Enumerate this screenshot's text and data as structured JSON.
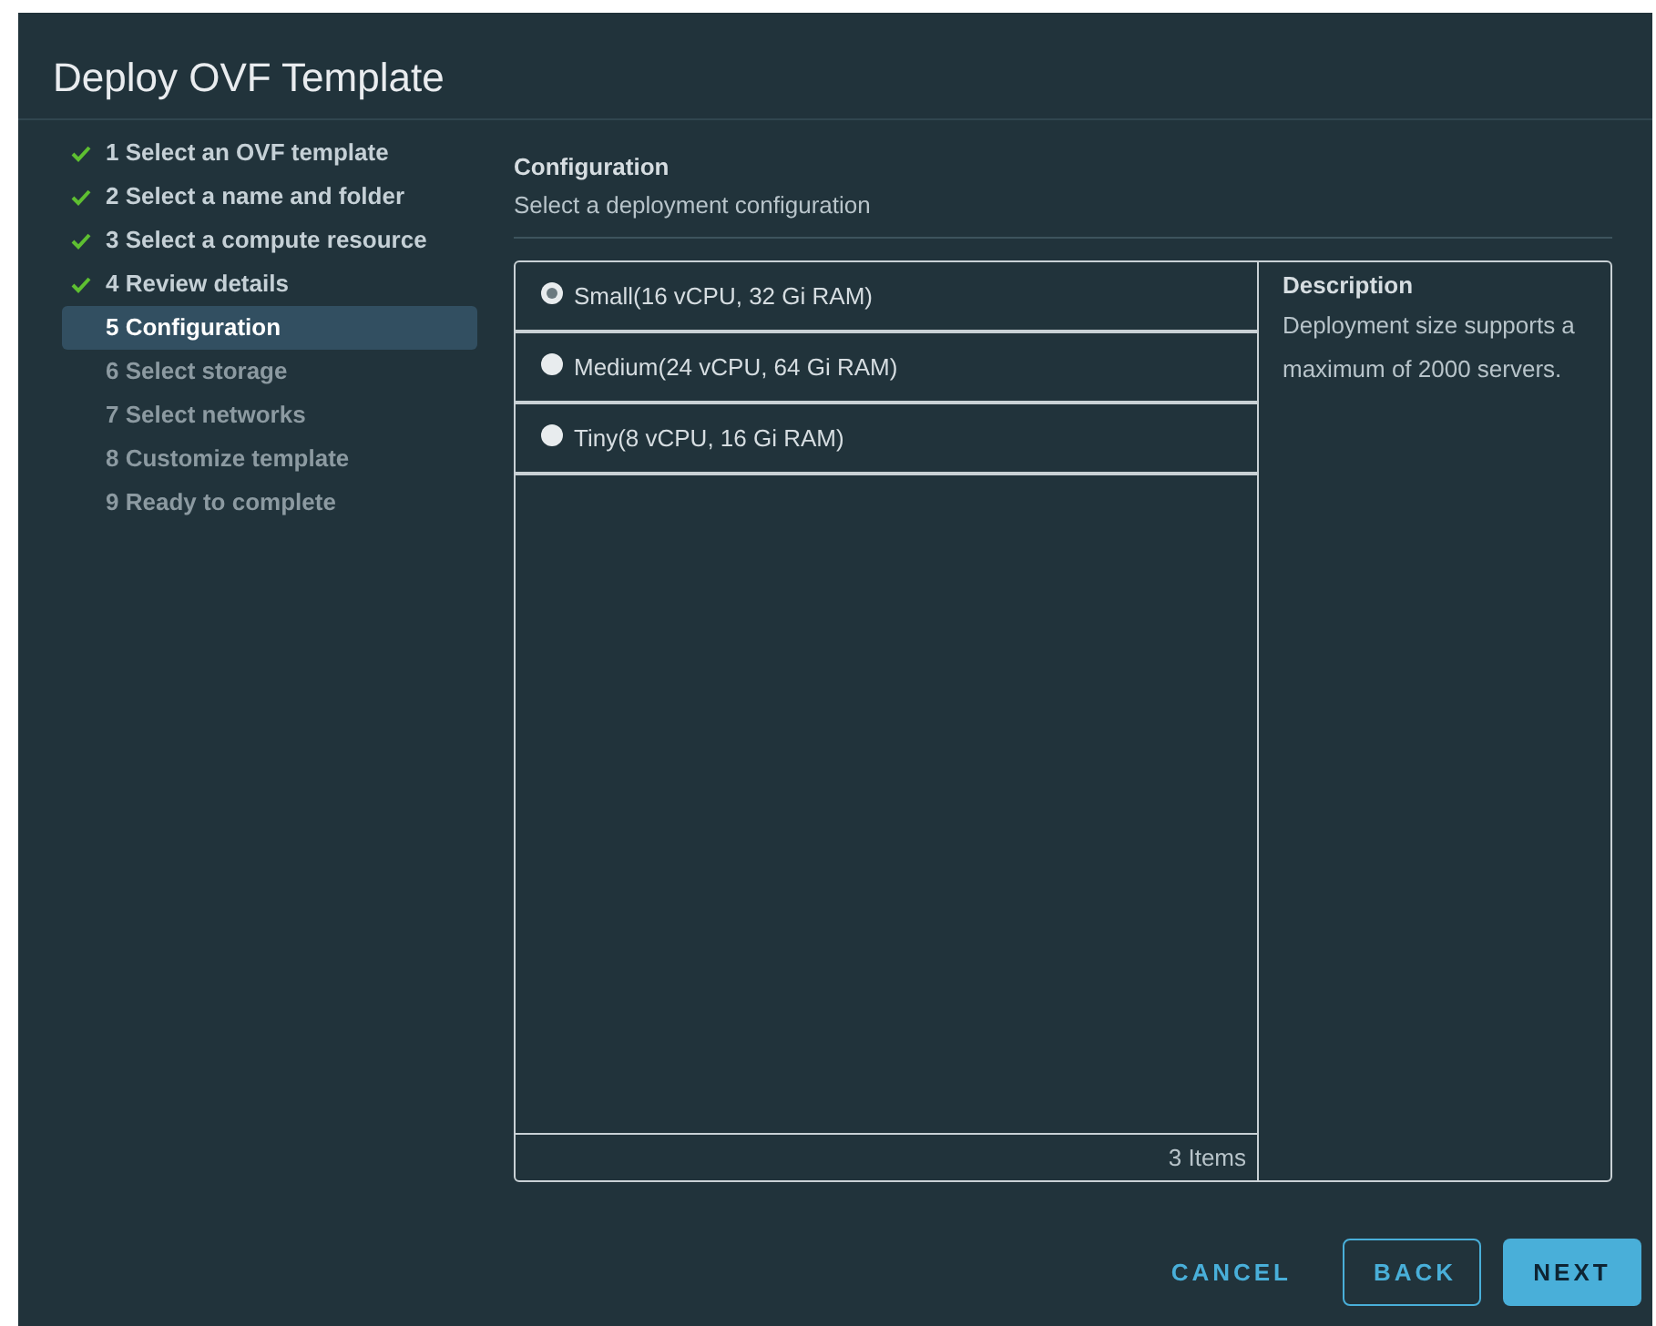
{
  "window": {
    "title": "Deploy OVF Template"
  },
  "steps": [
    {
      "label": "1 Select an OVF template",
      "done": true,
      "selected": false
    },
    {
      "label": "2 Select a name and folder",
      "done": true,
      "selected": false
    },
    {
      "label": "3 Select a compute resource",
      "done": true,
      "selected": false
    },
    {
      "label": "4 Review details",
      "done": true,
      "selected": false
    },
    {
      "label": "5 Configuration",
      "done": false,
      "selected": true
    },
    {
      "label": "6 Select storage",
      "done": false,
      "selected": false
    },
    {
      "label": "7 Select networks",
      "done": false,
      "selected": false
    },
    {
      "label": "8 Customize template",
      "done": false,
      "selected": false
    },
    {
      "label": "9 Ready to complete",
      "done": false,
      "selected": false
    }
  ],
  "section": {
    "title": "Configuration",
    "subtitle": "Select a deployment configuration"
  },
  "options": [
    {
      "label": "Small(16 vCPU, 32 Gi RAM)",
      "selected": true
    },
    {
      "label": "Medium(24 vCPU, 64 Gi RAM)",
      "selected": false
    },
    {
      "label": "Tiny(8 vCPU, 16 Gi RAM)",
      "selected": false
    }
  ],
  "footer": "3 Items",
  "description": {
    "title": "Description",
    "text": "Deployment size supports a maximum of 2000 servers."
  },
  "buttons": [
    {
      "label": "CANCEL",
      "kind": "flat"
    },
    {
      "label": "BACK",
      "kind": "outline"
    },
    {
      "label": "NEXT",
      "kind": "primary"
    }
  ]
}
